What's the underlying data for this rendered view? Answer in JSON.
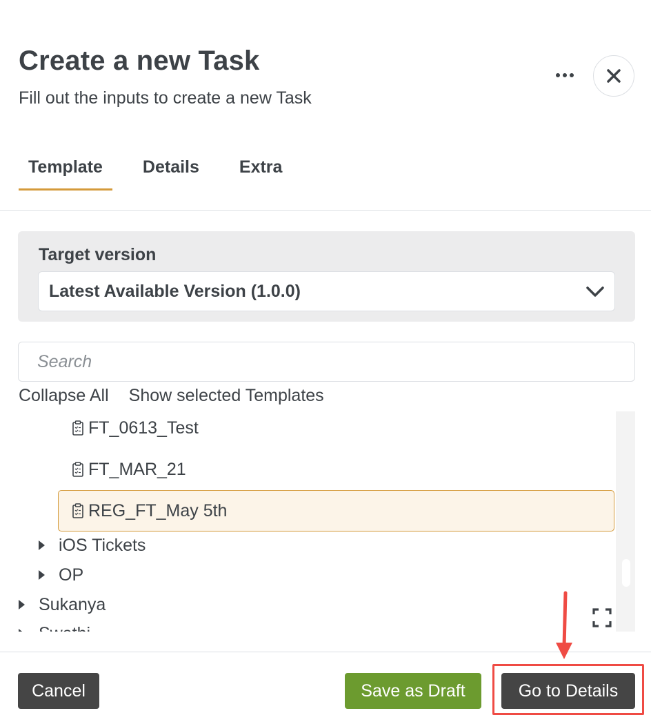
{
  "header": {
    "title": "Create a new Task",
    "subtitle": "Fill out the inputs to create a new Task",
    "more_icon": "more-horizontal-icon",
    "close_icon": "close-icon"
  },
  "tabs": [
    {
      "label": "Template",
      "active": true
    },
    {
      "label": "Details",
      "active": false
    },
    {
      "label": "Extra",
      "active": false
    }
  ],
  "version": {
    "label": "Target version",
    "selected": "Latest Available Version (1.0.0)"
  },
  "search": {
    "placeholder": "Search",
    "value": ""
  },
  "tree_actions": {
    "collapse_all": "Collapse All",
    "show_selected": "Show selected Templates"
  },
  "tree": {
    "templates": [
      {
        "label": "FT_0613_Test",
        "selected": false
      },
      {
        "label": "FT_MAR_21",
        "selected": false
      },
      {
        "label": "REG_FT_May 5th",
        "selected": true
      }
    ],
    "subfolders": [
      {
        "label": "iOS Tickets"
      },
      {
        "label": "OP"
      }
    ],
    "folders": [
      {
        "label": "Sukanya"
      },
      {
        "label": "Swathi"
      }
    ]
  },
  "footer": {
    "cancel_label": "Cancel",
    "draft_label": "Save as Draft",
    "next_label": "Go to Details"
  },
  "colors": {
    "accent": "#d49a3a",
    "text": "#3d4247",
    "draft_green": "#6c9b2f",
    "dark_button": "#454545",
    "annotation_red": "#ef4b44"
  }
}
